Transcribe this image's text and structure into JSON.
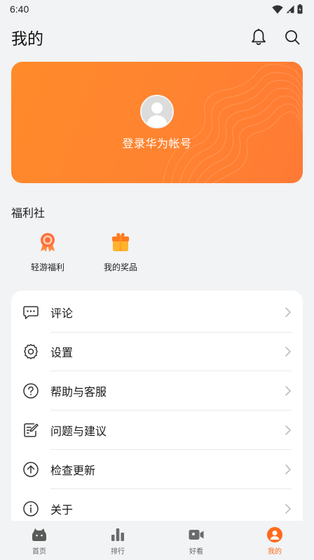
{
  "status_bar": {
    "time": "6:40"
  },
  "header": {
    "title": "我的"
  },
  "login_card": {
    "prompt": "登录华为帐号"
  },
  "welfare": {
    "title": "福利社",
    "items": [
      {
        "label": "轻游福利",
        "icon": "medal-icon"
      },
      {
        "label": "我的奖品",
        "icon": "gift-icon"
      }
    ]
  },
  "menu": {
    "items": [
      {
        "label": "评论",
        "icon": "comment-icon"
      },
      {
        "label": "设置",
        "icon": "gear-icon"
      },
      {
        "label": "帮助与客服",
        "icon": "help-icon"
      },
      {
        "label": "问题与建议",
        "icon": "feedback-icon"
      },
      {
        "label": "检查更新",
        "icon": "update-icon"
      },
      {
        "label": "关于",
        "icon": "info-icon"
      }
    ]
  },
  "bottom_nav": {
    "items": [
      {
        "label": "首页",
        "icon": "home-icon"
      },
      {
        "label": "排行",
        "icon": "ranking-icon"
      },
      {
        "label": "好看",
        "icon": "video-icon"
      },
      {
        "label": "我的",
        "icon": "profile-icon",
        "active": true
      }
    ]
  },
  "colors": {
    "accent": "#ff7a2a",
    "background": "#f1f3f5",
    "nav_active": "#ff6a1a"
  }
}
